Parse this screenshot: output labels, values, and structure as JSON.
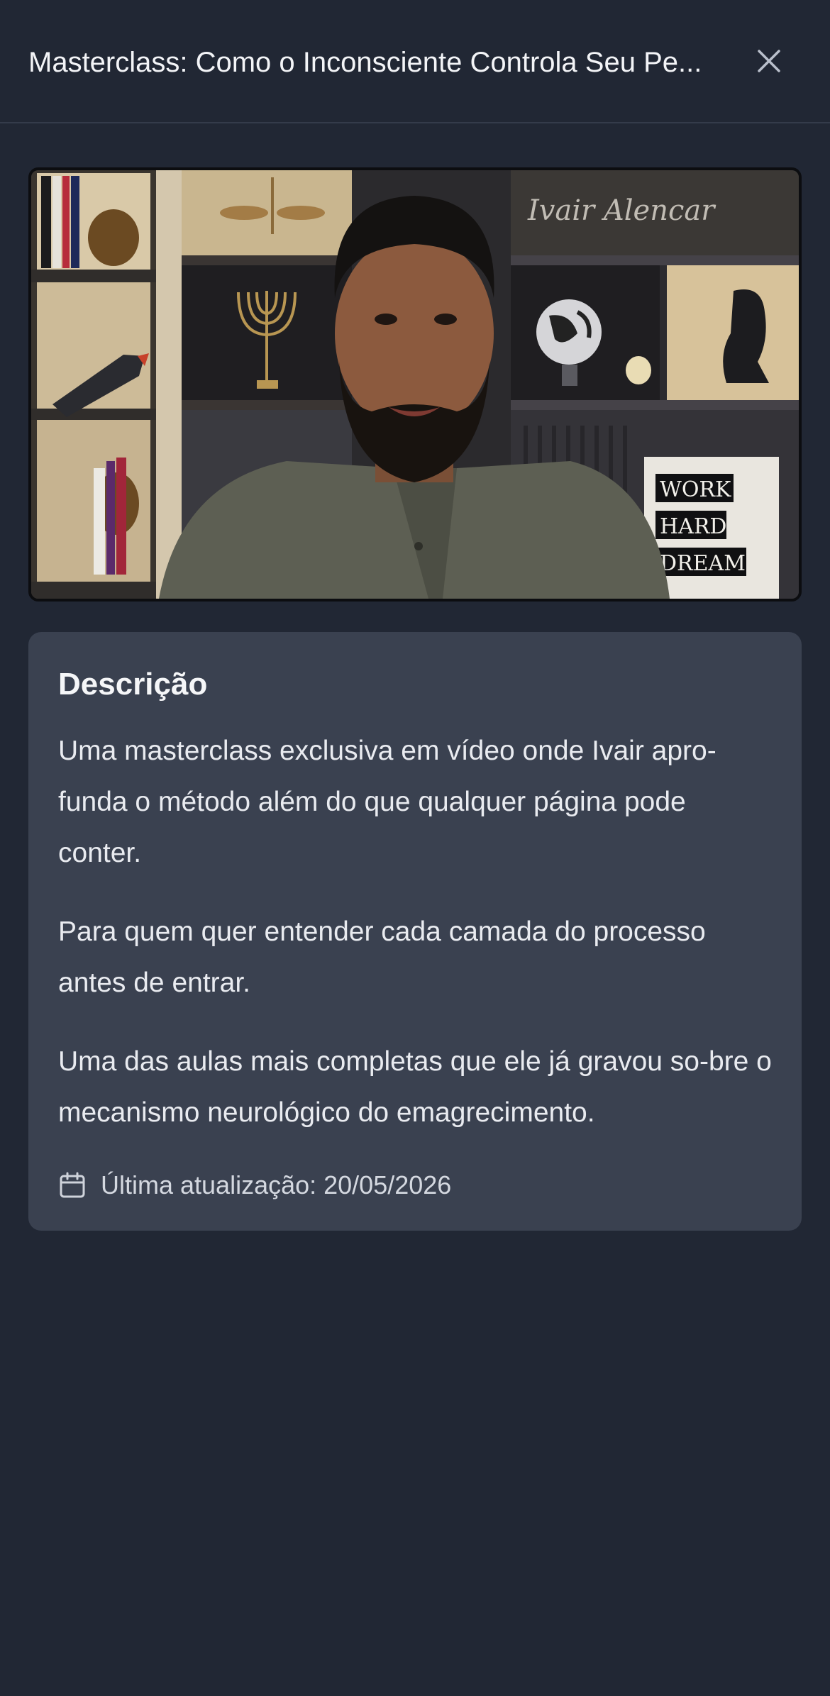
{
  "header": {
    "title": "Masterclass: Como o Inconsciente Controla Seu Pe...",
    "close_icon": "close-icon"
  },
  "video": {
    "background_text": "Ivair Alencar",
    "poster_lines": [
      "WORK",
      "HARD",
      "DREAM"
    ]
  },
  "description": {
    "heading": "Descrição",
    "paragraphs": [
      "Uma masterclass exclusiva em vídeo onde Ivair apro-funda o método além do que qualquer página pode conter.",
      "Para quem quer entender cada camada do processo antes de entrar.",
      "Uma das aulas mais completas que ele já gravou so-bre o mecanismo neurológico do emagrecimento."
    ],
    "updated_icon": "calendar-icon",
    "updated_label": "Última atualização: 20/05/2026"
  },
  "colors": {
    "background": "#212734",
    "card": "#3a4150",
    "divider": "#343b4a"
  }
}
